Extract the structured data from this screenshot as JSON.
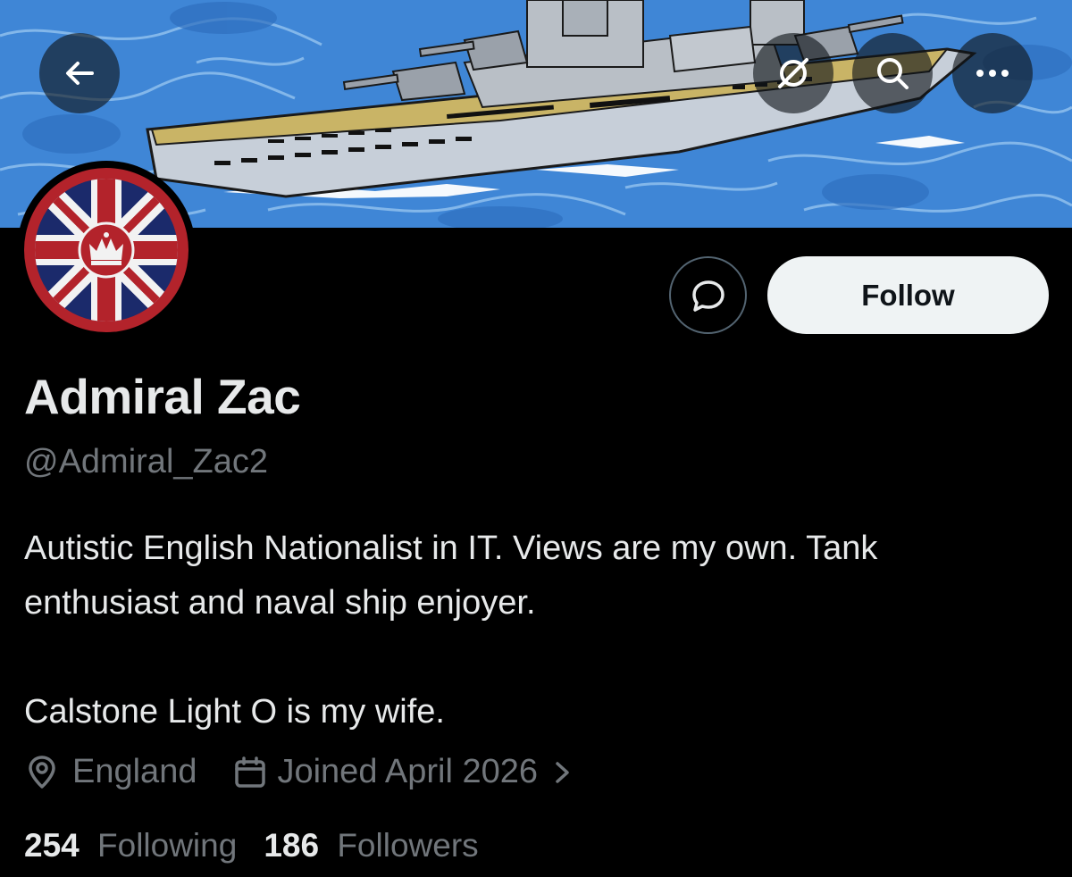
{
  "header": {
    "back_icon": "arrow-left-icon",
    "grok_icon": "grok-icon",
    "search_icon": "search-icon",
    "more_icon": "more-horizontal-icon",
    "banner_icon": "battleship-banner-image"
  },
  "avatar": {
    "icon": "union-jack-crown-avatar",
    "colors": {
      "red": "#b3232b",
      "blue": "#1b2a6b",
      "white": "#f2f2f2"
    }
  },
  "actions": {
    "message_icon": "message-bubble-icon",
    "follow_label": "Follow"
  },
  "profile": {
    "name": "Admiral Zac",
    "handle": "@Admiral_Zac2",
    "bio_line1": "Autistic English Nationalist in IT. Views are my own. Tank",
    "bio_line2": "enthusiast and naval ship enjoyer.",
    "bio_line3": "Calstone Light O is my wife.",
    "location": "England",
    "joined": "Joined April 2026"
  },
  "stats": {
    "following_count": "254",
    "following_label": "Following",
    "followers_count": "186",
    "followers_label": "Followers"
  },
  "colors": {
    "background": "#000000",
    "text_primary": "#e7e9ea",
    "text_secondary": "#71767b",
    "follow_bg": "#eff3f4",
    "sea": "#3f86d6"
  }
}
